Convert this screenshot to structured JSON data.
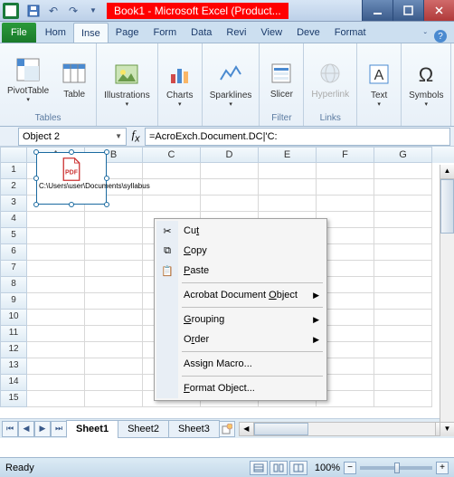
{
  "titlebar": {
    "title": "Book1 - Microsoft Excel (Product..."
  },
  "tabs": {
    "file": "File",
    "items": [
      "Hom",
      "Inse",
      "Page",
      "Form",
      "Data",
      "Revi",
      "View",
      "Deve",
      "Format"
    ],
    "active_index": 1
  },
  "ribbon": {
    "groups": [
      {
        "label": "Tables",
        "buttons": [
          {
            "name": "pivottable",
            "label": "PivotTable",
            "dd": true
          },
          {
            "name": "table",
            "label": "Table"
          }
        ]
      },
      {
        "label": "",
        "buttons": [
          {
            "name": "illustrations",
            "label": "Illustrations",
            "dd": true
          }
        ]
      },
      {
        "label": "",
        "buttons": [
          {
            "name": "charts",
            "label": "Charts",
            "dd": true
          }
        ]
      },
      {
        "label": "",
        "buttons": [
          {
            "name": "sparklines",
            "label": "Sparklines",
            "dd": true
          }
        ]
      },
      {
        "label": "Filter",
        "buttons": [
          {
            "name": "slicer",
            "label": "Slicer"
          }
        ]
      },
      {
        "label": "Links",
        "buttons": [
          {
            "name": "hyperlink",
            "label": "Hyperlink",
            "disabled": true
          }
        ]
      },
      {
        "label": "",
        "buttons": [
          {
            "name": "text",
            "label": "Text",
            "dd": true
          }
        ]
      },
      {
        "label": "",
        "buttons": [
          {
            "name": "symbols",
            "label": "Symbols",
            "dd": true
          }
        ]
      }
    ]
  },
  "namebox": {
    "value": "Object 2"
  },
  "formula": {
    "value": "=AcroExch.Document.DC|'C:"
  },
  "columns": [
    "A",
    "B",
    "C",
    "D",
    "E",
    "F",
    "G"
  ],
  "row_count": 15,
  "embedded": {
    "icon_label": "PDF",
    "caption": "C:\\Users\\user\\Documents\\syllabus"
  },
  "context_menu": {
    "items": [
      {
        "key": "cut",
        "label_pre": "Cu",
        "accel": "t",
        "label_post": "",
        "icon": "cut",
        "arrow": false
      },
      {
        "key": "copy",
        "label_pre": "",
        "accel": "C",
        "label_post": "opy",
        "icon": "copy",
        "arrow": false
      },
      {
        "key": "paste",
        "label_pre": "",
        "accel": "P",
        "label_post": "aste",
        "icon": "paste",
        "arrow": false
      },
      {
        "sep": true
      },
      {
        "key": "acrobat",
        "label_pre": "Acrobat Document ",
        "accel": "O",
        "label_post": "bject",
        "arrow": true
      },
      {
        "sep": true
      },
      {
        "key": "grouping",
        "label_pre": "",
        "accel": "G",
        "label_post": "rouping",
        "arrow": true
      },
      {
        "key": "order",
        "label_pre": "O",
        "accel": "r",
        "label_post": "der",
        "arrow": true
      },
      {
        "sep": true
      },
      {
        "key": "macro",
        "label_pre": "Assi",
        "accel": "g",
        "label_post": "n Macro...",
        "arrow": false
      },
      {
        "sep": true
      },
      {
        "key": "format",
        "label_pre": "",
        "accel": "F",
        "label_post": "ormat Object...",
        "arrow": false
      }
    ]
  },
  "sheets": {
    "tabs": [
      "Sheet1",
      "Sheet2",
      "Sheet3"
    ],
    "active_index": 0
  },
  "status": {
    "text": "Ready",
    "zoom": "100%"
  }
}
